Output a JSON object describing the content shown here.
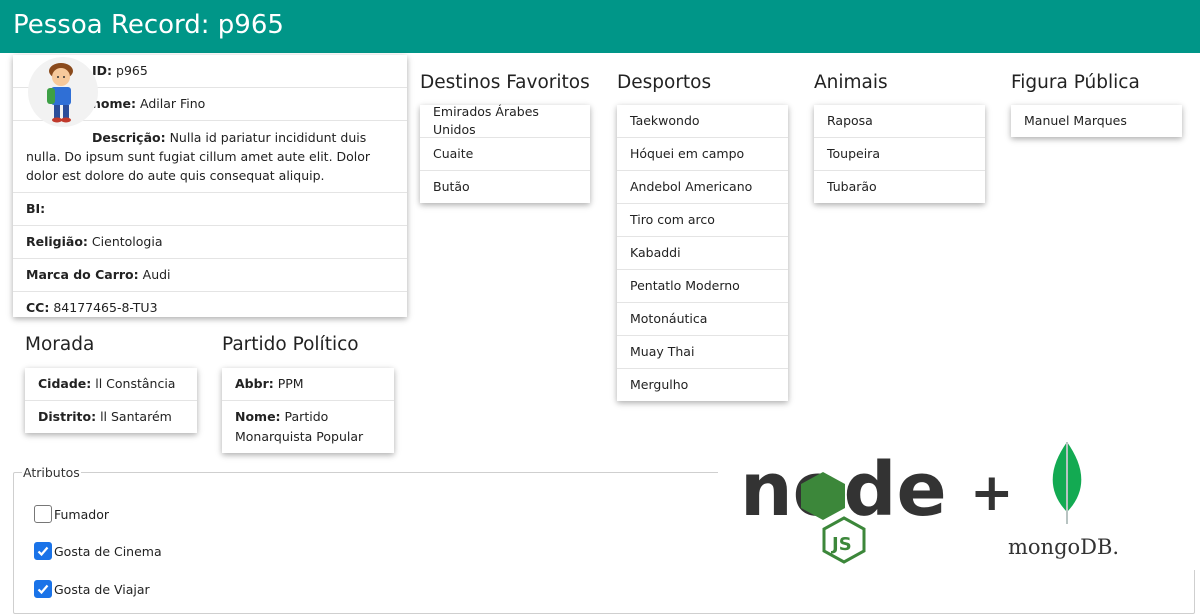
{
  "header": {
    "title": "Pessoa Record: p965"
  },
  "profile": {
    "id_label": "ID:",
    "id_value": "p965",
    "nome_label": "nome:",
    "nome_value": "Adilar Fino",
    "descricao_label": "Descrição:",
    "descricao_value": "Nulla id pariatur incididunt duis nulla. Do ipsum sunt fugiat cillum amet aute elit. Dolor dolor est dolore do aute quis consequat aliquip.",
    "bi_label": "BI:",
    "bi_value": "",
    "religiao_label": "Religião:",
    "religiao_value": "Cientologia",
    "carro_label": "Marca do Carro:",
    "carro_value": "Audi",
    "cc_label": "CC:",
    "cc_value": "84177465-8-TU3"
  },
  "destinos": {
    "title": "Destinos Favoritos",
    "items": [
      "Emirados Árabes Unidos",
      "Cuaite",
      "Butão"
    ]
  },
  "desportos": {
    "title": "Desportos",
    "items": [
      "Taekwondo",
      "Hóquei em campo",
      "Andebol Americano",
      "Tiro com arco",
      "Kabaddi",
      "Pentatlo Moderno",
      "Motonáutica",
      "Muay Thai",
      "Mergulho"
    ]
  },
  "animais": {
    "title": "Animais",
    "items": [
      "Raposa",
      "Toupeira",
      "Tubarão"
    ]
  },
  "figura": {
    "title": "Figura Pública",
    "items": [
      "Manuel Marques"
    ]
  },
  "morada": {
    "title": "Morada",
    "cidade_label": "Cidade:",
    "cidade_value": "ll Constância",
    "distrito_label": "Distrito:",
    "distrito_value": "ll Santarém"
  },
  "partido": {
    "title": "Partido Político",
    "abbr_label": "Abbr:",
    "abbr_value": "PPM",
    "nome_label": "Nome:",
    "nome_value": "Partido Monarquista Popular"
  },
  "atributos": {
    "legend": "Atributos",
    "items": [
      {
        "label": "Fumador",
        "checked": false
      },
      {
        "label": "Gosta de Cinema",
        "checked": true
      },
      {
        "label": "Gosta de Viajar",
        "checked": true
      }
    ]
  },
  "logos": {
    "node_text": "node",
    "js_text": "JS",
    "plus": "+",
    "mongo_text": "mongoDB.",
    "node_color": "#333333",
    "node_green": "#3c873a",
    "mongo_green": "#13aa52"
  }
}
